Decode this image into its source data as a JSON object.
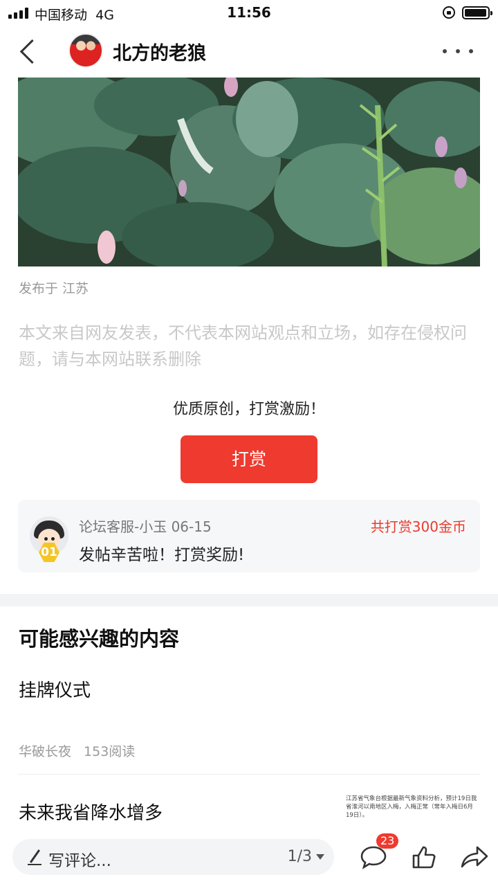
{
  "status_bar": {
    "carrier": "中国移动",
    "network": "4G",
    "time": "11:56"
  },
  "nav": {
    "title": "北方的老狼"
  },
  "post": {
    "location": "发布于 江苏",
    "disclaimer": "本文来自网友发表，不代表本网站观点和立场，如存在侵权问题，请与本网站联系删除",
    "reward_prompt": "优质原创，打赏激励！",
    "reward_button": "打赏"
  },
  "tip": {
    "name_date": "论坛客服-小玉 06-15",
    "level": "01",
    "message": "发帖辛苦啦！打赏奖励!",
    "total": "共打赏300金币"
  },
  "recommend": {
    "heading": "可能感兴趣的内容",
    "items": [
      {
        "title": "挂牌仪式",
        "author": "华破长夜",
        "reads": "153阅读"
      },
      {
        "title": "未来我省降水增多",
        "thumb_text": "江苏省气象台根据最新气象资料分析，预计19日我省淮河以南地区入梅，入梅正常（常年入梅日6月19日）。"
      }
    ]
  },
  "bottom_bar": {
    "comment_placeholder": "写评论...",
    "page_indicator": "1/3",
    "comment_count": "23"
  },
  "icons": {
    "back": "chevron-left-icon",
    "more": "more-dots-icon",
    "comment": "comment-bubble-icon",
    "like": "thumbs-up-icon",
    "share": "share-arrow-icon",
    "pen": "pen-icon"
  },
  "colors": {
    "accent": "#ee3a2f",
    "muted_text": "#999999",
    "card_bg": "#f6f7f9"
  }
}
